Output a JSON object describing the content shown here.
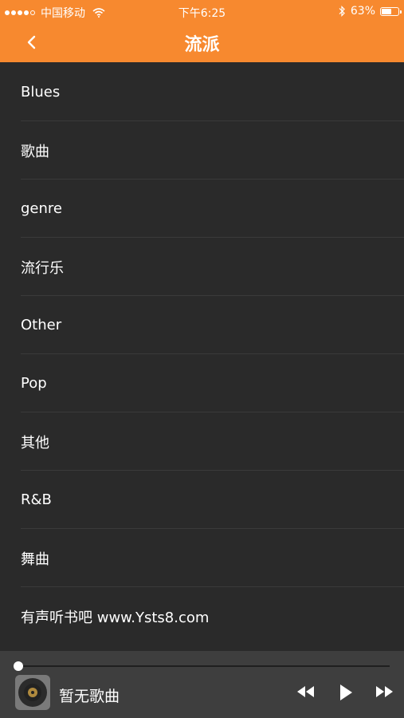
{
  "status_bar": {
    "carrier": "中国移动",
    "time": "下午6:25",
    "battery": "63%",
    "battery_level": 0.63,
    "signal_bars": 4,
    "icons": [
      "wifi-icon",
      "bluetooth-icon",
      "battery-icon"
    ]
  },
  "nav": {
    "title": "流派",
    "back_icon": "chevron-left-icon"
  },
  "genres": [
    "Blues",
    "歌曲",
    "genre",
    "流行乐",
    "Other",
    "Pop",
    "其他",
    "R&B",
    "舞曲",
    "有声听书吧 www.Ysts8.com"
  ],
  "player": {
    "song": "暂无歌曲",
    "progress": 0,
    "icons": [
      "album-art-icon",
      "rewind-icon",
      "play-icon",
      "fast-forward-icon"
    ]
  },
  "colors": {
    "accent": "#f7892f",
    "background": "#2a2a2a",
    "player_bar": "#3e3e3e"
  }
}
